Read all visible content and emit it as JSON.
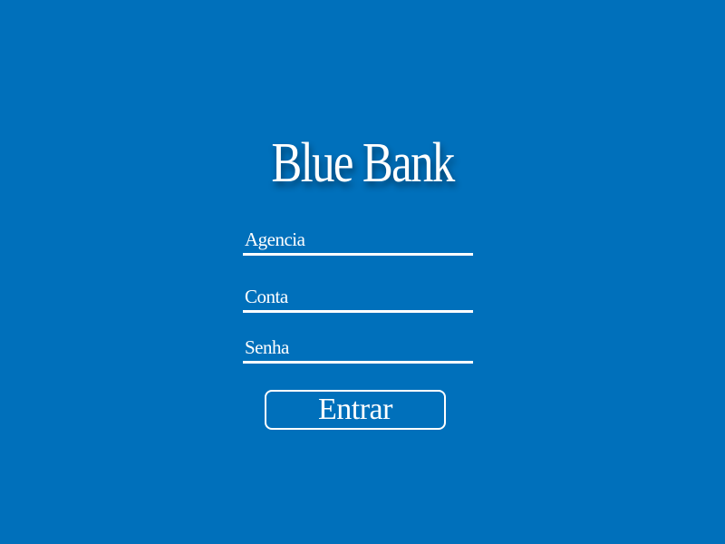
{
  "brand": {
    "title": "Blue Bank"
  },
  "form": {
    "agencia": {
      "placeholder": "Agencia",
      "value": ""
    },
    "conta": {
      "placeholder": "Conta",
      "value": ""
    },
    "senha": {
      "placeholder": "Senha",
      "value": ""
    },
    "submit_label": "Entrar"
  },
  "colors": {
    "background": "#0070bb",
    "foreground": "#ffffff"
  }
}
